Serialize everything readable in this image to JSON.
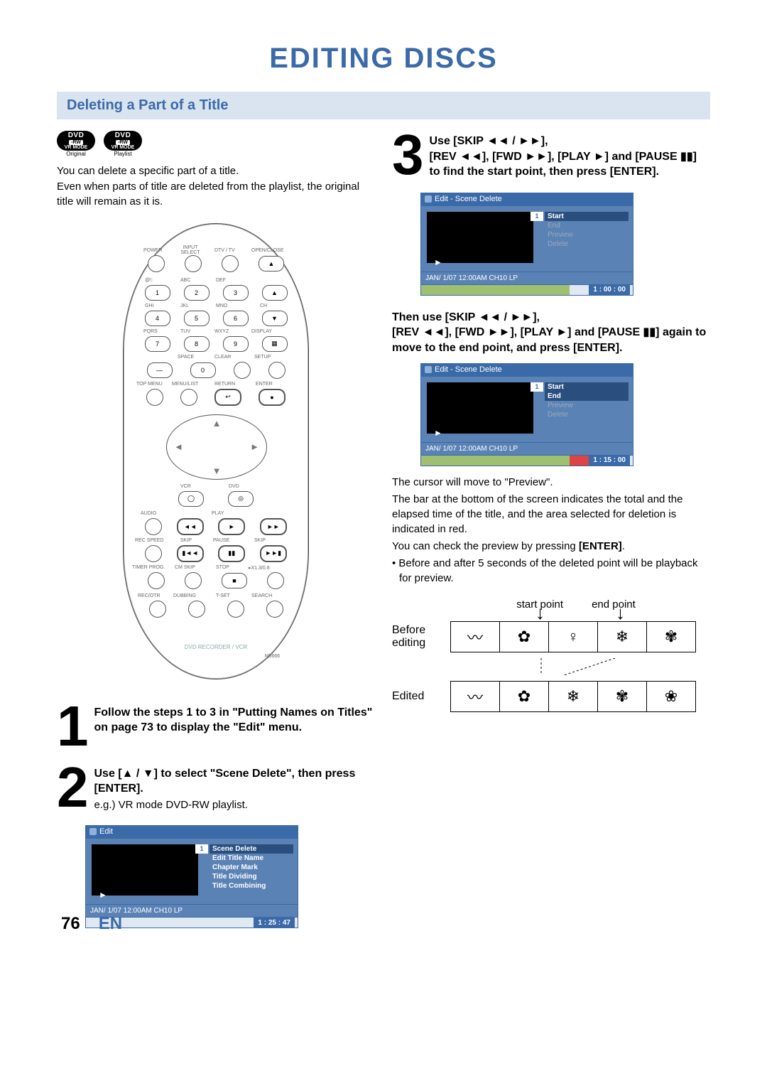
{
  "page": {
    "title": "EDITING DISCS",
    "number": "76",
    "lang": "EN"
  },
  "section": {
    "heading": "Deleting a Part of a Title"
  },
  "tags": {
    "dvd_label_top": "DVD",
    "dvd_label_mid": "-RW",
    "dvd_label_bot": "VR MODE",
    "cap_original": "Original",
    "cap_playlist": "Playlist"
  },
  "intro": {
    "line1": "You can delete a specific part of a title.",
    "line2": "Even when parts of title are deleted from the playlist, the original title will remain as it is."
  },
  "remote": {
    "labels": {
      "power": "POWER",
      "input_select": "INPUT SELECT",
      "dtvtv": "DTV / TV",
      "open_close": "OPEN/CLOSE",
      "abc_a": "@!:",
      "abc_b": "ABC",
      "abc_c": "DEF",
      "ghi": "GHI",
      "jkl": "JKL",
      "mno": "MNO",
      "ch": "CH",
      "pqrs": "PQRS",
      "tuv": "TUV",
      "wxyz": "WXYZ",
      "display": "DISPLAY",
      "space": "SPACE",
      "clear": "CLEAR",
      "setup": "SETUP",
      "topmenu": "TOP MENU",
      "menulist": "MENU/LIST",
      "return": "RETURN",
      "enter": "ENTER",
      "vcr": "VCR",
      "dvd": "DVD",
      "audio": "AUDIO",
      "play": "PLAY",
      "recspeed": "REC SPEED",
      "skip": "SKIP",
      "pause": "PAUSE",
      "timerprog": "TIMER PROG.",
      "cmskip": "CM SKIP",
      "stop": "STOP",
      "x13": "▸X1.3/0.8",
      "recotr": "REC/OTR",
      "dubbing": "DUBBING",
      "tset": "T-SET",
      "search": "SEARCH",
      "footer": "DVD RECORDER / VCR",
      "model": "NB666"
    },
    "nums": [
      "1",
      "2",
      "3",
      "4",
      "5",
      "6",
      "7",
      "8",
      "9",
      "0"
    ]
  },
  "steps": {
    "s1": "Follow the steps 1 to 3 in \"Putting Names on Titles\" on page 73 to display the \"Edit\" menu.",
    "s2_strong": "Use [▲ / ▼] to select \"Scene Delete\", then press [ENTER].",
    "s2_sub": "e.g.) VR mode DVD-RW playlist.",
    "s3_l1": "Use [SKIP ◄◄ / ►►],",
    "s3_l2": "[REV ◄◄], [FWD ►►], [PLAY ►] and [PAUSE ▮▮] to find the start point, then press [ENTER].",
    "s3b_l1": "Then use [SKIP ◄◄ / ►►],",
    "s3b_l2": "[REV ◄◄], [FWD ►►], [PLAY ►] and [PAUSE ▮▮] again to move to the end point, and press [ENTER]."
  },
  "osd1": {
    "title": "Edit",
    "badge": "1",
    "items": [
      "Scene Delete",
      "Edit Title Name",
      "Chapter Mark",
      "Title Dividing",
      "Title Combining"
    ],
    "hot_index": 0,
    "status_left": "JAN/ 1/07 12:00AM CH10   LP",
    "time": "1 : 25 : 47",
    "fill_pct": 0
  },
  "osd2": {
    "title": "Edit - Scene Delete",
    "badge": "1",
    "items": [
      "Start",
      "End",
      "Preview",
      "Delete"
    ],
    "hot": [
      0
    ],
    "status_left": "JAN/ 1/07 12:00AM CH10   LP",
    "time": "1 : 00 : 00",
    "fill_pct": 70,
    "red_start": 0,
    "red_end": 0
  },
  "osd3": {
    "title": "Edit - Scene Delete",
    "badge": "1",
    "items": [
      "Start",
      "End",
      "Preview",
      "Delete"
    ],
    "hot": [
      0,
      1
    ],
    "status_left": "JAN/ 1/07 12:00AM CH10   LP",
    "time": "1 : 15 : 00",
    "fill_pct": 86,
    "red_start": 70,
    "red_end": 86
  },
  "body_para": {
    "p1": "The cursor will move to \"Preview\".",
    "p2": "The bar at the bottom of the screen indicates the total and the elapsed time of the title, and the area selected for deletion is indicated in red.",
    "p3_pre": "You can check the preview by pressing ",
    "p3_bold": "[ENTER]",
    "p3_post": ".",
    "p4": "• Before and after 5 seconds of the deleted point will be playback for preview."
  },
  "diagram": {
    "start_label": "start point",
    "end_label": "end point",
    "before_l1": "Before",
    "before_l2": "editing",
    "edited": "Edited",
    "glyphs_before": [
      "〰",
      "✿",
      "♀",
      "❄",
      "✾"
    ],
    "glyphs_edited": [
      "〰",
      "✿",
      "❄",
      "✾",
      "❀"
    ]
  }
}
